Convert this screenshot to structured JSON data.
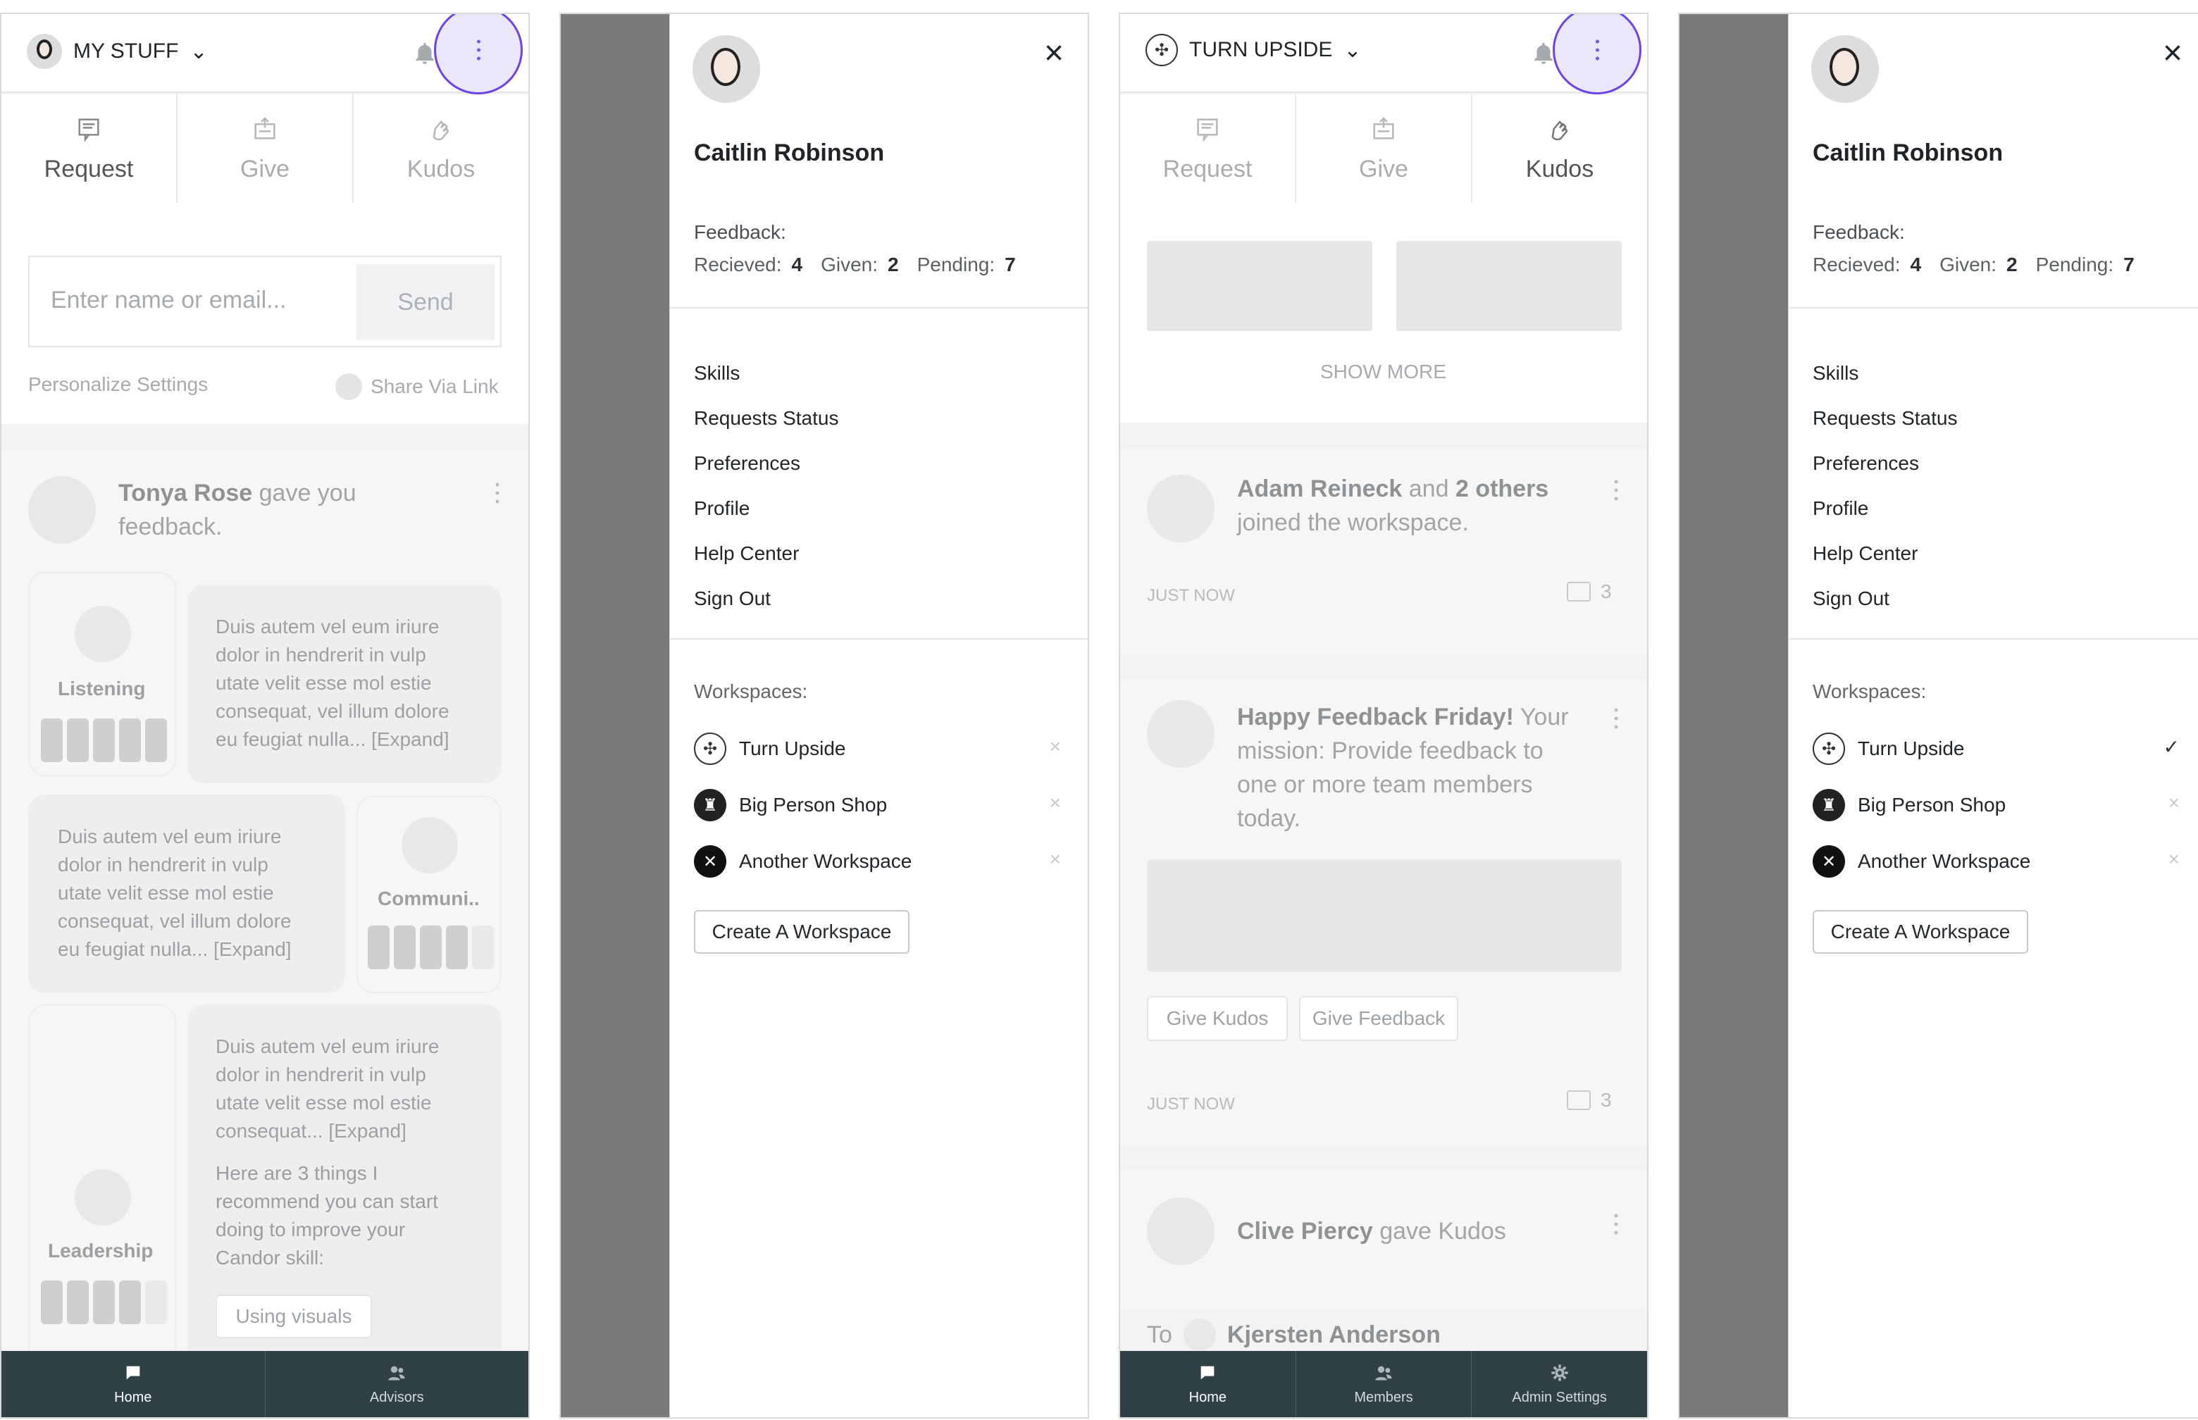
{
  "screen1": {
    "workspace": "MY STUFF",
    "tabs": [
      "Request",
      "Give",
      "Kudos"
    ],
    "input_placeholder": "Enter name or email...",
    "send": "Send",
    "personalize": "Personalize Settings",
    "share": "Share Via Link",
    "feed_name": "Tonya Rose",
    "feed_rest": " gave you",
    "feed_line2": "feedback.",
    "skills": [
      "Listening",
      "Communi..",
      "Leadership"
    ],
    "lorem1": [
      "Duis autem vel eum iriure",
      "dolor in hendrerit in vulp",
      "utate velit esse mol estie",
      "consequat, vel illum dolore",
      "eu feugiat nulla... [Expand]"
    ],
    "lorem2": [
      "Duis autem vel eum iriure",
      "dolor in hendrerit in vulp",
      "utate velit esse mol estie",
      "consequat, vel illum dolore",
      "eu feugiat nulla... [Expand]"
    ],
    "lorem3": [
      "Duis autem vel eum iriure",
      "dolor in hendrerit in vulp",
      "utate velit esse mol estie",
      "consequat... [Expand]"
    ],
    "advice": [
      "Here are 3 things I",
      "recommend you can start",
      "doing to improve your",
      "Candor skill:"
    ],
    "pill": "Using visuals",
    "nav": [
      "Home",
      "Advisors"
    ]
  },
  "drawer": {
    "name": "Caitlin Robinson",
    "feedback_label": "Feedback:",
    "received_label": "Recieved:",
    "received": "4",
    "given_label": "Given:",
    "given": "2",
    "pending_label": "Pending:",
    "pending": "7",
    "menu": [
      "Skills",
      "Requests Status",
      "Preferences",
      "Profile",
      "Help Center",
      "Sign Out"
    ],
    "workspaces_label": "Workspaces:",
    "workspaces": [
      "Turn Upside",
      "Big Person Shop",
      "Another Workspace"
    ],
    "create": "Create A Workspace"
  },
  "screen3": {
    "workspace": "TURN UPSIDE",
    "tabs": [
      "Request",
      "Give",
      "Kudos"
    ],
    "show_more": "SHOW MORE",
    "feed1_name": "Adam Reineck",
    "feed1_mid": " and ",
    "feed1_bold": "2 others",
    "feed1_line2": "joined the workspace.",
    "time": "JUST NOW",
    "comments": "3",
    "feed2_title": "Happy Feedback Friday!",
    "feed2_rest": " Your",
    "feed2_lines": [
      "mission: Provide feedback to",
      "one or more team members",
      "today."
    ],
    "give_kudos": "Give Kudos",
    "give_feedback": "Give Feedback",
    "feed3_name": "Clive Piercy",
    "feed3_rest": " gave Kudos",
    "to": "To",
    "to_name": "Kjersten Anderson",
    "nav": [
      "Home",
      "Members",
      "Admin Settings"
    ]
  }
}
